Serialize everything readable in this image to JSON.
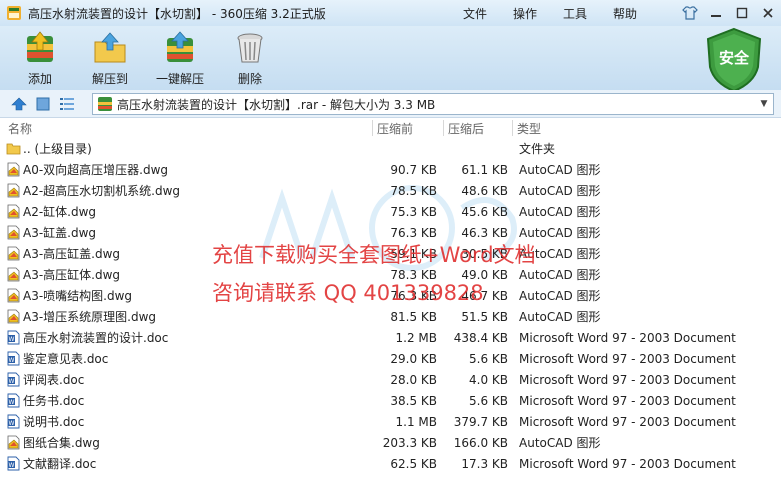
{
  "window": {
    "title": "高压水射流装置的设计【水切割】 - 360压缩 3.2正式版",
    "menus": [
      "文件",
      "操作",
      "工具",
      "帮助"
    ]
  },
  "toolbar": {
    "add_label": "添加",
    "extract_to_label": "解压到",
    "one_click_extract_label": "一键解压",
    "delete_label": "删除",
    "security_label": "安全"
  },
  "address": {
    "path": "高压水射流装置的设计【水切割】.rar - 解包大小为 3.3 MB"
  },
  "columns": {
    "name": "名称",
    "packed": "压缩前",
    "size": "压缩后",
    "type": "类型"
  },
  "files": [
    {
      "name": ".. (上级目录)",
      "packed": "",
      "size": "",
      "type": "文件夹",
      "icon": "folder-icon"
    },
    {
      "name": "A0-双向超高压增压器.dwg",
      "packed": "90.7 KB",
      "size": "61.1 KB",
      "type": "AutoCAD 图形",
      "icon": "dwg-file-icon"
    },
    {
      "name": "A2-超高压水切割机系统.dwg",
      "packed": "78.5 KB",
      "size": "48.6 KB",
      "type": "AutoCAD 图形",
      "icon": "dwg-file-icon"
    },
    {
      "name": "A2-缸体.dwg",
      "packed": "75.3 KB",
      "size": "45.6 KB",
      "type": "AutoCAD 图形",
      "icon": "dwg-file-icon"
    },
    {
      "name": "A3-缸盖.dwg",
      "packed": "76.3 KB",
      "size": "46.3 KB",
      "type": "AutoCAD 图形",
      "icon": "dwg-file-icon"
    },
    {
      "name": "A3-高压缸盖.dwg",
      "packed": "59.1 KB",
      "size": "30.5 KB",
      "type": "AutoCAD 图形",
      "icon": "dwg-file-icon"
    },
    {
      "name": "A3-高压缸体.dwg",
      "packed": "78.3 KB",
      "size": "49.0 KB",
      "type": "AutoCAD 图形",
      "icon": "dwg-file-icon"
    },
    {
      "name": "A3-喷嘴结构图.dwg",
      "packed": "76.3 KB",
      "size": "46.7 KB",
      "type": "AutoCAD 图形",
      "icon": "dwg-file-icon"
    },
    {
      "name": "A3-增压系统原理图.dwg",
      "packed": "81.5 KB",
      "size": "51.5 KB",
      "type": "AutoCAD 图形",
      "icon": "dwg-file-icon"
    },
    {
      "name": "高压水射流装置的设计.doc",
      "packed": "1.2 MB",
      "size": "438.4 KB",
      "type": "Microsoft Word 97 - 2003 Document",
      "icon": "doc-file-icon"
    },
    {
      "name": "鉴定意见表.doc",
      "packed": "29.0 KB",
      "size": "5.6 KB",
      "type": "Microsoft Word 97 - 2003 Document",
      "icon": "doc-file-icon"
    },
    {
      "name": "评阅表.doc",
      "packed": "28.0 KB",
      "size": "4.0 KB",
      "type": "Microsoft Word 97 - 2003 Document",
      "icon": "doc-file-icon"
    },
    {
      "name": "任务书.doc",
      "packed": "38.5 KB",
      "size": "5.6 KB",
      "type": "Microsoft Word 97 - 2003 Document",
      "icon": "doc-file-icon"
    },
    {
      "name": "说明书.doc",
      "packed": "1.1 MB",
      "size": "379.7 KB",
      "type": "Microsoft Word 97 - 2003 Document",
      "icon": "doc-file-icon"
    },
    {
      "name": "图纸合集.dwg",
      "packed": "203.3 KB",
      "size": "166.0 KB",
      "type": "AutoCAD 图形",
      "icon": "dwg-file-icon"
    },
    {
      "name": "文献翻译.doc",
      "packed": "62.5 KB",
      "size": "17.3 KB",
      "type": "Microsoft Word 97 - 2003 Document",
      "icon": "doc-file-icon"
    }
  ],
  "watermark": {
    "line1": "充值下载购买全套图纸+Word文档",
    "line2": "咨询请联系 QQ 401339828"
  },
  "colors": {
    "accent": "#2f8a3a",
    "watermark": "#e03030"
  }
}
